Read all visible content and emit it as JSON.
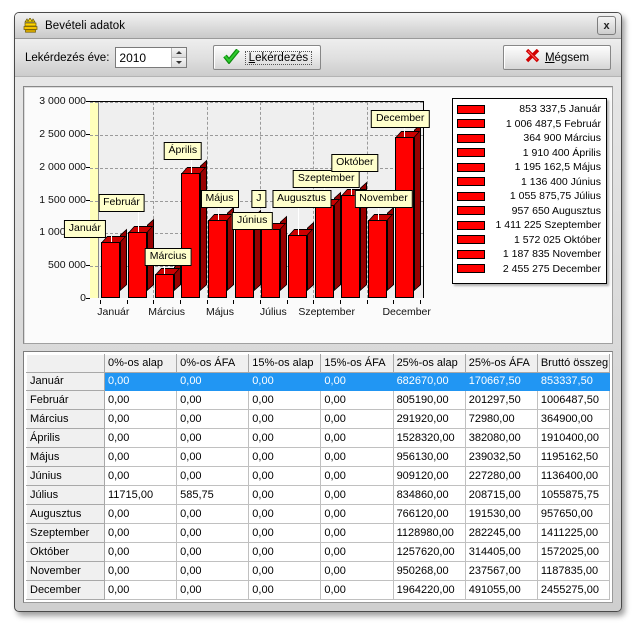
{
  "window": {
    "title": "Bevételi adatok",
    "icon": "money-icon",
    "close_label": "x"
  },
  "toolbar": {
    "year_label": "Lekérdezés éve:",
    "year_value": "2010",
    "query_button": "Lekérdezés",
    "query_accel": "L",
    "cancel_button": "Mégsem",
    "cancel_accel": "M",
    "check_icon": "green-check-icon",
    "x_icon": "red-x-icon"
  },
  "chart_data": {
    "type": "bar",
    "title": "",
    "xlabel": "",
    "ylabel": "",
    "ylim": [
      0,
      3000000
    ],
    "yticks": [
      "0",
      "500 000",
      "1 000 000",
      "1 500 000",
      "2 000 000",
      "2 500 000",
      "3 000 000"
    ],
    "ytick_values": [
      0,
      500000,
      1000000,
      1500000,
      2000000,
      2500000,
      3000000
    ],
    "grid": true,
    "legend_position": "right",
    "categories": [
      "Január",
      "Február",
      "Március",
      "Április",
      "Május",
      "Június",
      "Július",
      "Augusztus",
      "Szeptember",
      "Október",
      "November",
      "December"
    ],
    "xtick_labels": [
      "Január",
      "Március",
      "Május",
      "Július",
      "Szeptember",
      "December"
    ],
    "values": [
      853337.5,
      1006487.5,
      364900,
      1910400,
      1195162.5,
      1136400,
      1055875.75,
      957650,
      1411225,
      1572025,
      1187835,
      2455275
    ],
    "bar_labels": [
      "Január",
      "Február",
      "Március",
      "Április",
      "Május",
      "Június",
      "J",
      "Augusztus",
      "Szeptember",
      "Október",
      "November",
      "December"
    ],
    "series": [
      {
        "name": "Bruttó összeg",
        "values": [
          853337.5,
          1006487.5,
          364900,
          1910400,
          1195162.5,
          1136400,
          1055875.75,
          957650,
          1411225,
          1572025,
          1187835,
          2455275
        ]
      }
    ],
    "legend": [
      {
        "value": "853 337,5",
        "label": "Január"
      },
      {
        "value": "1 006 487,5",
        "label": "Február"
      },
      {
        "value": "364 900",
        "label": "Március"
      },
      {
        "value": "1 910 400",
        "label": "Április"
      },
      {
        "value": "1 195 162,5",
        "label": "Május"
      },
      {
        "value": "1 136 400",
        "label": "Június"
      },
      {
        "value": "1 055 875,75",
        "label": "Július"
      },
      {
        "value": "957 650",
        "label": "Augusztus"
      },
      {
        "value": "1 411 225",
        "label": "Szeptember"
      },
      {
        "value": "1 572 025",
        "label": "Október"
      },
      {
        "value": "1 187 835",
        "label": "November"
      },
      {
        "value": "2 455 275",
        "label": "December"
      }
    ],
    "colors": {
      "bar_face": "#ff0000",
      "bar_side": "#990000",
      "bar_top": "#cc0000",
      "plot_bg": "#efefef",
      "axis_band": "#ffffbb",
      "callout_bg": "#ffffcc"
    }
  },
  "table": {
    "columns": [
      "",
      "0%-os alap",
      "0%-os ÁFA",
      "15%-os alap",
      "15%-os ÁFA",
      "25%-os alap",
      "25%-os ÁFA",
      "Bruttó összeg"
    ],
    "selected_row_index": 0,
    "rows": [
      {
        "month": "Január",
        "cells": [
          "0,00",
          "0,00",
          "0,00",
          "0,00",
          "682670,00",
          "170667,50",
          "853337,50"
        ]
      },
      {
        "month": "Február",
        "cells": [
          "0,00",
          "0,00",
          "0,00",
          "0,00",
          "805190,00",
          "201297,50",
          "1006487,50"
        ]
      },
      {
        "month": "Március",
        "cells": [
          "0,00",
          "0,00",
          "0,00",
          "0,00",
          "291920,00",
          "72980,00",
          "364900,00"
        ]
      },
      {
        "month": "Április",
        "cells": [
          "0,00",
          "0,00",
          "0,00",
          "0,00",
          "1528320,00",
          "382080,00",
          "1910400,00"
        ]
      },
      {
        "month": "Május",
        "cells": [
          "0,00",
          "0,00",
          "0,00",
          "0,00",
          "956130,00",
          "239032,50",
          "1195162,50"
        ]
      },
      {
        "month": "Június",
        "cells": [
          "0,00",
          "0,00",
          "0,00",
          "0,00",
          "909120,00",
          "227280,00",
          "1136400,00"
        ]
      },
      {
        "month": "Július",
        "cells": [
          "11715,00",
          "585,75",
          "0,00",
          "0,00",
          "834860,00",
          "208715,00",
          "1055875,75"
        ]
      },
      {
        "month": "Augusztus",
        "cells": [
          "0,00",
          "0,00",
          "0,00",
          "0,00",
          "766120,00",
          "191530,00",
          "957650,00"
        ]
      },
      {
        "month": "Szeptember",
        "cells": [
          "0,00",
          "0,00",
          "0,00",
          "0,00",
          "1128980,00",
          "282245,00",
          "1411225,00"
        ]
      },
      {
        "month": "Október",
        "cells": [
          "0,00",
          "0,00",
          "0,00",
          "0,00",
          "1257620,00",
          "314405,00",
          "1572025,00"
        ]
      },
      {
        "month": "November",
        "cells": [
          "0,00",
          "0,00",
          "0,00",
          "0,00",
          "950268,00",
          "237567,00",
          "1187835,00"
        ]
      },
      {
        "month": "December",
        "cells": [
          "0,00",
          "0,00",
          "0,00",
          "0,00",
          "1964220,00",
          "491055,00",
          "2455275,00"
        ]
      }
    ]
  }
}
